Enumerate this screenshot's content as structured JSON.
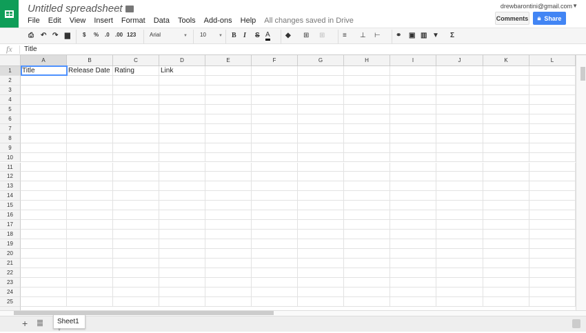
{
  "app": {
    "title": "Untitled spreadsheet",
    "save_status": "All changes saved in Drive",
    "account_email": "drewbarontini@gmail.com",
    "comments_label": "Comments",
    "share_label": "Share",
    "brand_color": "#0f9d58",
    "share_color": "#4285f4"
  },
  "menu": [
    "File",
    "Edit",
    "View",
    "Insert",
    "Format",
    "Data",
    "Tools",
    "Add-ons",
    "Help"
  ],
  "toolbar": {
    "currency": "$",
    "percent": "%",
    "decimal_decrease": ".0",
    "decimal_increase": ".00",
    "more_formats": "123",
    "font": "Arial",
    "font_size": "10",
    "bold": "B",
    "italic": "I",
    "strikethrough": "S",
    "text_color": "A",
    "functions": "Σ"
  },
  "formula_bar": {
    "fx": "fx",
    "value": "Title"
  },
  "columns": [
    "A",
    "B",
    "C",
    "D",
    "E",
    "F",
    "G",
    "H",
    "I",
    "J",
    "K",
    "L"
  ],
  "rows": [
    "1",
    "2",
    "3",
    "4",
    "5",
    "6",
    "7",
    "8",
    "9",
    "10",
    "11",
    "12",
    "13",
    "14",
    "15",
    "16",
    "17",
    "18",
    "19",
    "20",
    "21",
    "22",
    "23",
    "24",
    "25"
  ],
  "row1": [
    "Title",
    "Release Date",
    "Rating",
    "Link"
  ],
  "sheets": [
    "Sheet1"
  ],
  "selected_cell": "A1"
}
